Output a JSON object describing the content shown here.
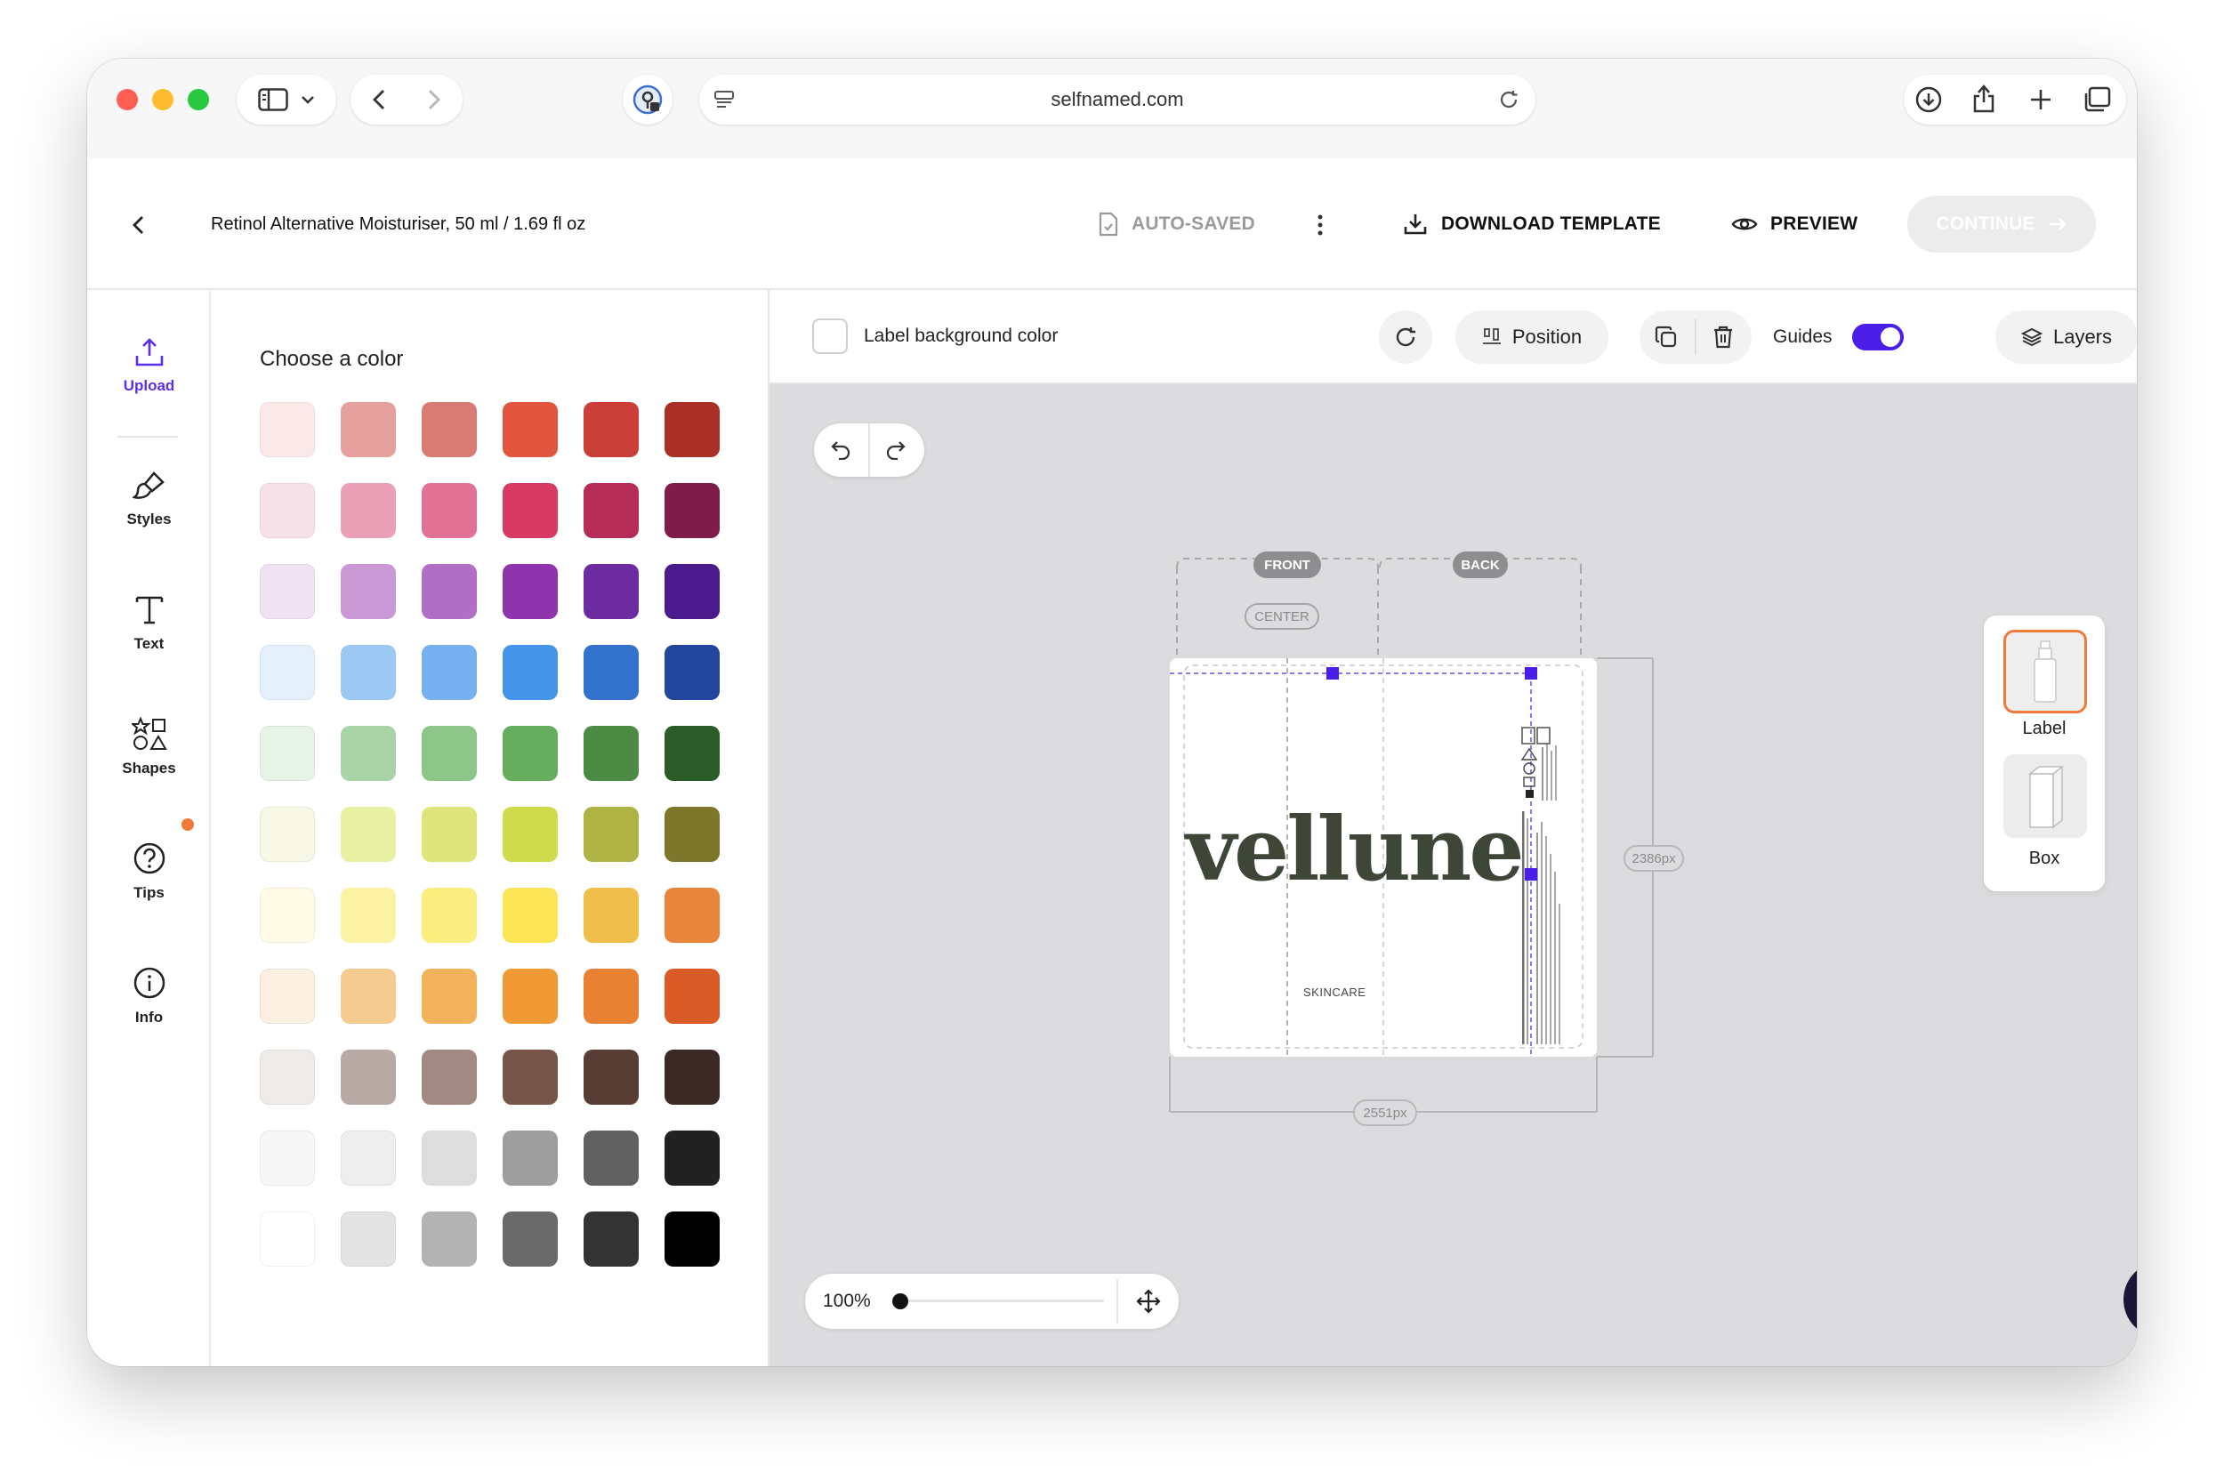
{
  "browser": {
    "url": "selfnamed.com"
  },
  "header": {
    "product_title": "Retinol Alternative Moisturiser, 50 ml / 1.69 fl oz",
    "autosave_status": "AUTO-SAVED",
    "download_label": "DOWNLOAD TEMPLATE",
    "preview_label": "PREVIEW",
    "continue_label": "CONTINUE"
  },
  "sidebar": {
    "items": [
      {
        "label": "Upload",
        "icon": "upload-icon",
        "active": true
      },
      {
        "label": "Styles",
        "icon": "brush-icon"
      },
      {
        "label": "Text",
        "icon": "text-icon"
      },
      {
        "label": "Shapes",
        "icon": "shapes-icon"
      },
      {
        "label": "Tips",
        "icon": "help-icon"
      },
      {
        "label": "Info",
        "icon": "info-icon"
      }
    ],
    "accent_color": "#5b2ee8",
    "notification_color": "#f07a3a"
  },
  "color_panel": {
    "title": "Choose a color",
    "swatches": [
      [
        "#fbe9ea",
        "#e6a09d",
        "#d97a74",
        "#e25640",
        "#c93e36",
        "#a92f27"
      ],
      [
        "#f7e1e9",
        "#eba0b8",
        "#e27196",
        "#d93a63",
        "#b52d57",
        "#7f1c49"
      ],
      [
        "#f0e2f2",
        "#c998d5",
        "#b06ec4",
        "#8f34ad",
        "#6c2ba1",
        "#4b1b8d"
      ],
      [
        "#e4f1fd",
        "#9dc8f3",
        "#77b0ef",
        "#4494ea",
        "#3271cc",
        "#21469b"
      ],
      [
        "#e6f3e6",
        "#a9d4a7",
        "#8ec689",
        "#66ad5d",
        "#4b8b43",
        "#2b5c28"
      ],
      [
        "#f7f9e6",
        "#e8f0a2",
        "#dfe57b",
        "#cfdb4c",
        "#afb344",
        "#7d772b"
      ],
      [
        "#fffbe6",
        "#fbf2a3",
        "#fbed7f",
        "#fbe455",
        "#f0bf4b",
        "#e8853a"
      ],
      [
        "#fcf0e2",
        "#f6cb92",
        "#f3b35c",
        "#f09a36",
        "#e88232",
        "#d95b26"
      ],
      [
        "#efebe8",
        "#b8a9a4",
        "#a08a81",
        "#775549",
        "#583d35",
        "#3b2925"
      ],
      [
        "#f7f7f7",
        "#eeeeee",
        "#dddddd",
        "#9e9e9e",
        "#616161",
        "#212121"
      ],
      [
        "#ffffff",
        "#e3e3e3",
        "#b3b3b3",
        "#6a6a6a",
        "#333333",
        "#000000"
      ]
    ]
  },
  "toolbar": {
    "bg_color_label": "Label background color",
    "position_label": "Position",
    "guides_label": "Guides",
    "guides_on": true,
    "layers_label": "Layers"
  },
  "canvas": {
    "front_tag": "FRONT",
    "back_tag": "BACK",
    "center_tag": "CENTER",
    "height_dim": "2386px",
    "width_dim": "2551px",
    "brand": "vellune",
    "tagline": "SKINCARE",
    "zoom": "100%"
  },
  "package": {
    "label_tab": "Label",
    "box_tab": "Box",
    "selected": "Label",
    "selected_color": "#f07a3a"
  }
}
